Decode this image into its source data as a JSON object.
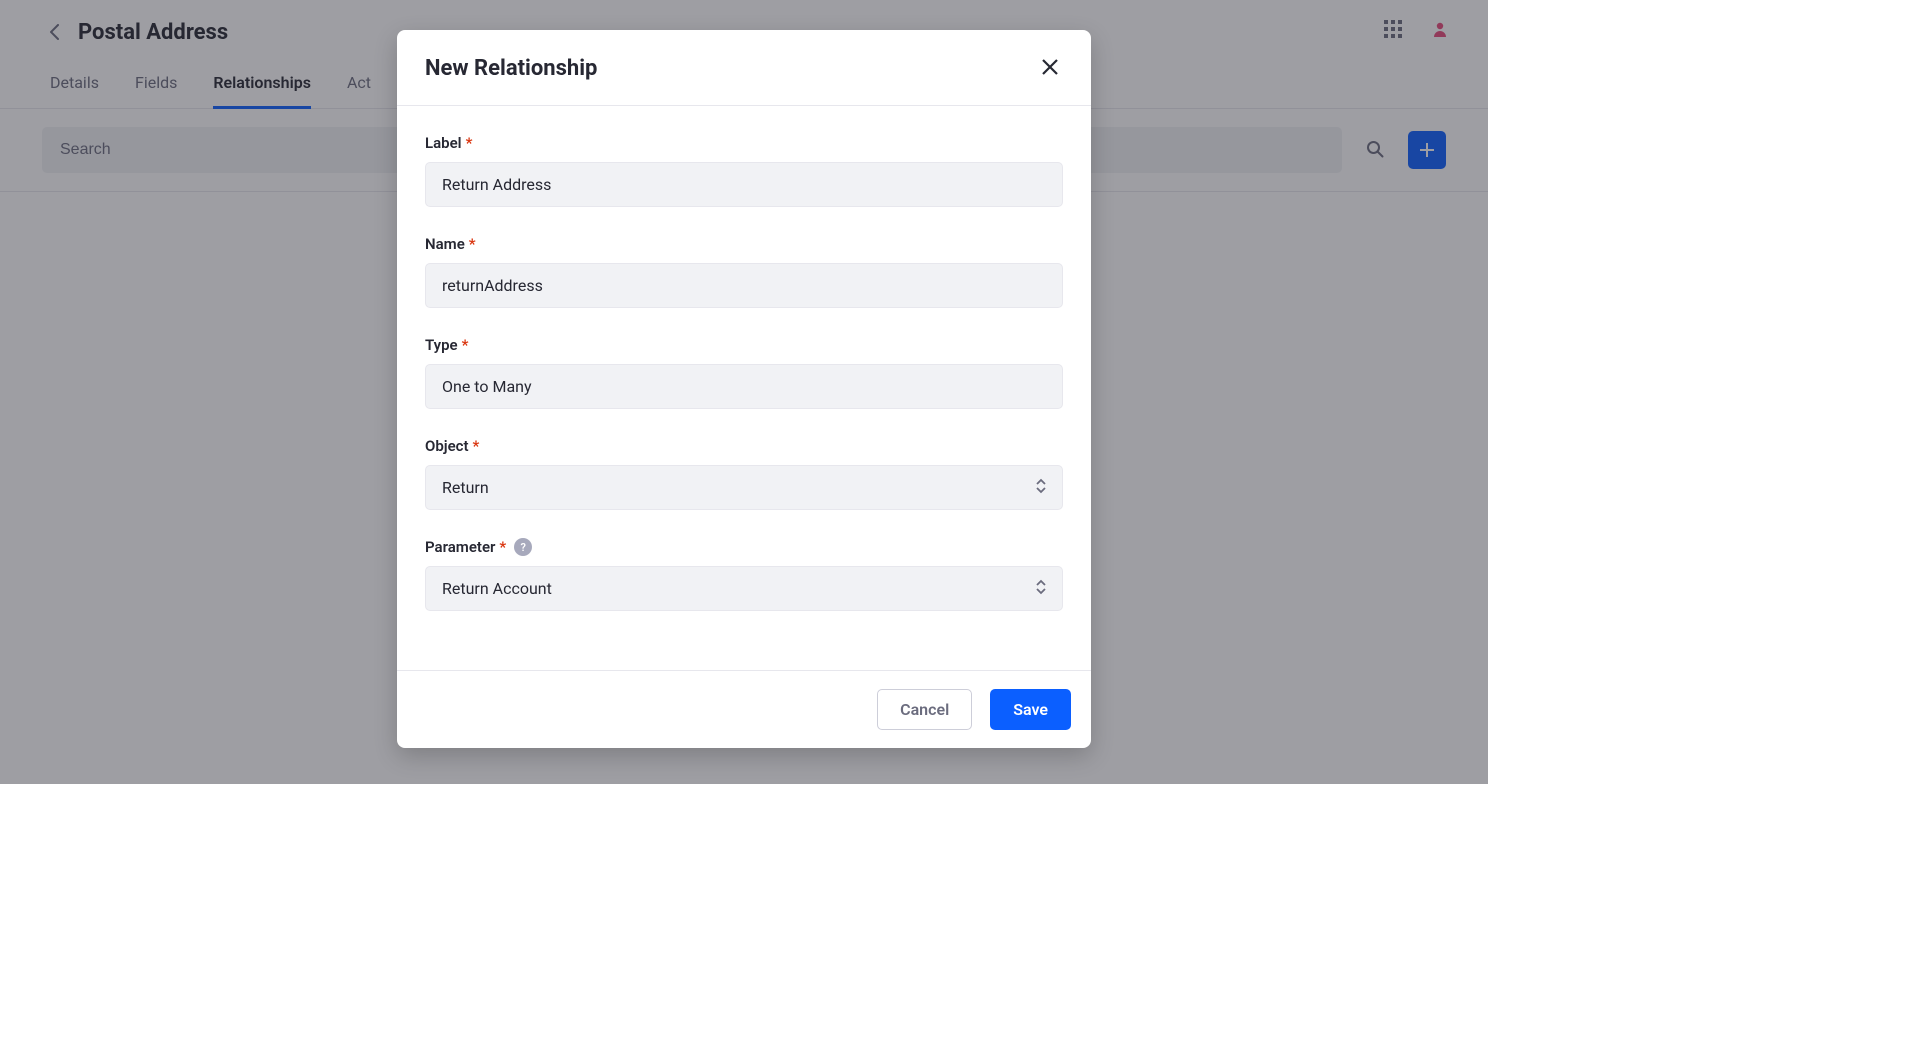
{
  "page": {
    "title": "Postal Address"
  },
  "tabs": {
    "details": "Details",
    "fields": "Fields",
    "relationships": "Relationships",
    "actions": "Act"
  },
  "toolbar": {
    "search_placeholder": "Search"
  },
  "modal": {
    "title": "New Relationship",
    "labels": {
      "label": "Label",
      "name": "Name",
      "type": "Type",
      "object": "Object",
      "parameter": "Parameter"
    },
    "values": {
      "label": "Return Address",
      "name": "returnAddress",
      "type": "One to Many",
      "object": "Return",
      "parameter": "Return Account"
    },
    "help_badge": "?",
    "buttons": {
      "cancel": "Cancel",
      "save": "Save"
    }
  }
}
